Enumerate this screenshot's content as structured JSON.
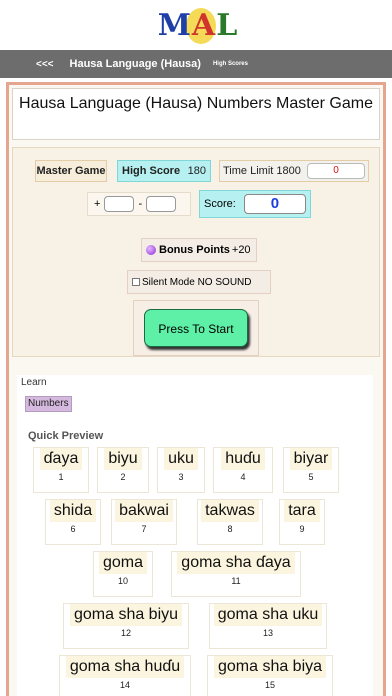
{
  "logo": {
    "letters": [
      "M",
      "A",
      "L"
    ]
  },
  "nav": {
    "back": "<<<",
    "title": "Hausa Language (Hausa)",
    "high_scores": "High Scores"
  },
  "title": "Hausa Language (Hausa) Numbers Master Game",
  "game": {
    "master_game": "Master Game",
    "high_score_label": "High Score",
    "high_score_value": "180",
    "time_limit_label": "Time Limit 1800",
    "time_value": "0",
    "plus": "+",
    "minus": "-",
    "score_label": "Score:",
    "score_value": "0",
    "bonus_label": "Bonus Points",
    "bonus_value": "+20",
    "silent_label": "Silent Mode NO SOUND",
    "start_button": "Press To Start"
  },
  "learn": {
    "label": "Learn",
    "tag": "Numbers",
    "quick_preview": "Quick Preview",
    "items": [
      {
        "word": "ɗaya",
        "num": "1"
      },
      {
        "word": "biyu",
        "num": "2"
      },
      {
        "word": "uku",
        "num": "3"
      },
      {
        "word": "huɗu",
        "num": "4"
      },
      {
        "word": "biyar",
        "num": "5"
      },
      {
        "word": "shida",
        "num": "6"
      },
      {
        "word": "bakwai",
        "num": "7"
      },
      {
        "word": "takwas",
        "num": "8"
      },
      {
        "word": "tara",
        "num": "9"
      },
      {
        "word": "goma",
        "num": "10"
      },
      {
        "word": "goma sha ɗaya",
        "num": "11"
      },
      {
        "word": "goma sha biyu",
        "num": "12"
      },
      {
        "word": "goma sha uku",
        "num": "13"
      },
      {
        "word": "goma sha huɗu",
        "num": "14"
      },
      {
        "word": "goma sha biya",
        "num": "15"
      }
    ]
  },
  "colors": {
    "nav_bg": "#6d6d6d",
    "frame_border": "#e4a68e",
    "start_button": "#5df0a6",
    "score_blue": "#1e3fe0",
    "time_red": "#d11111"
  }
}
